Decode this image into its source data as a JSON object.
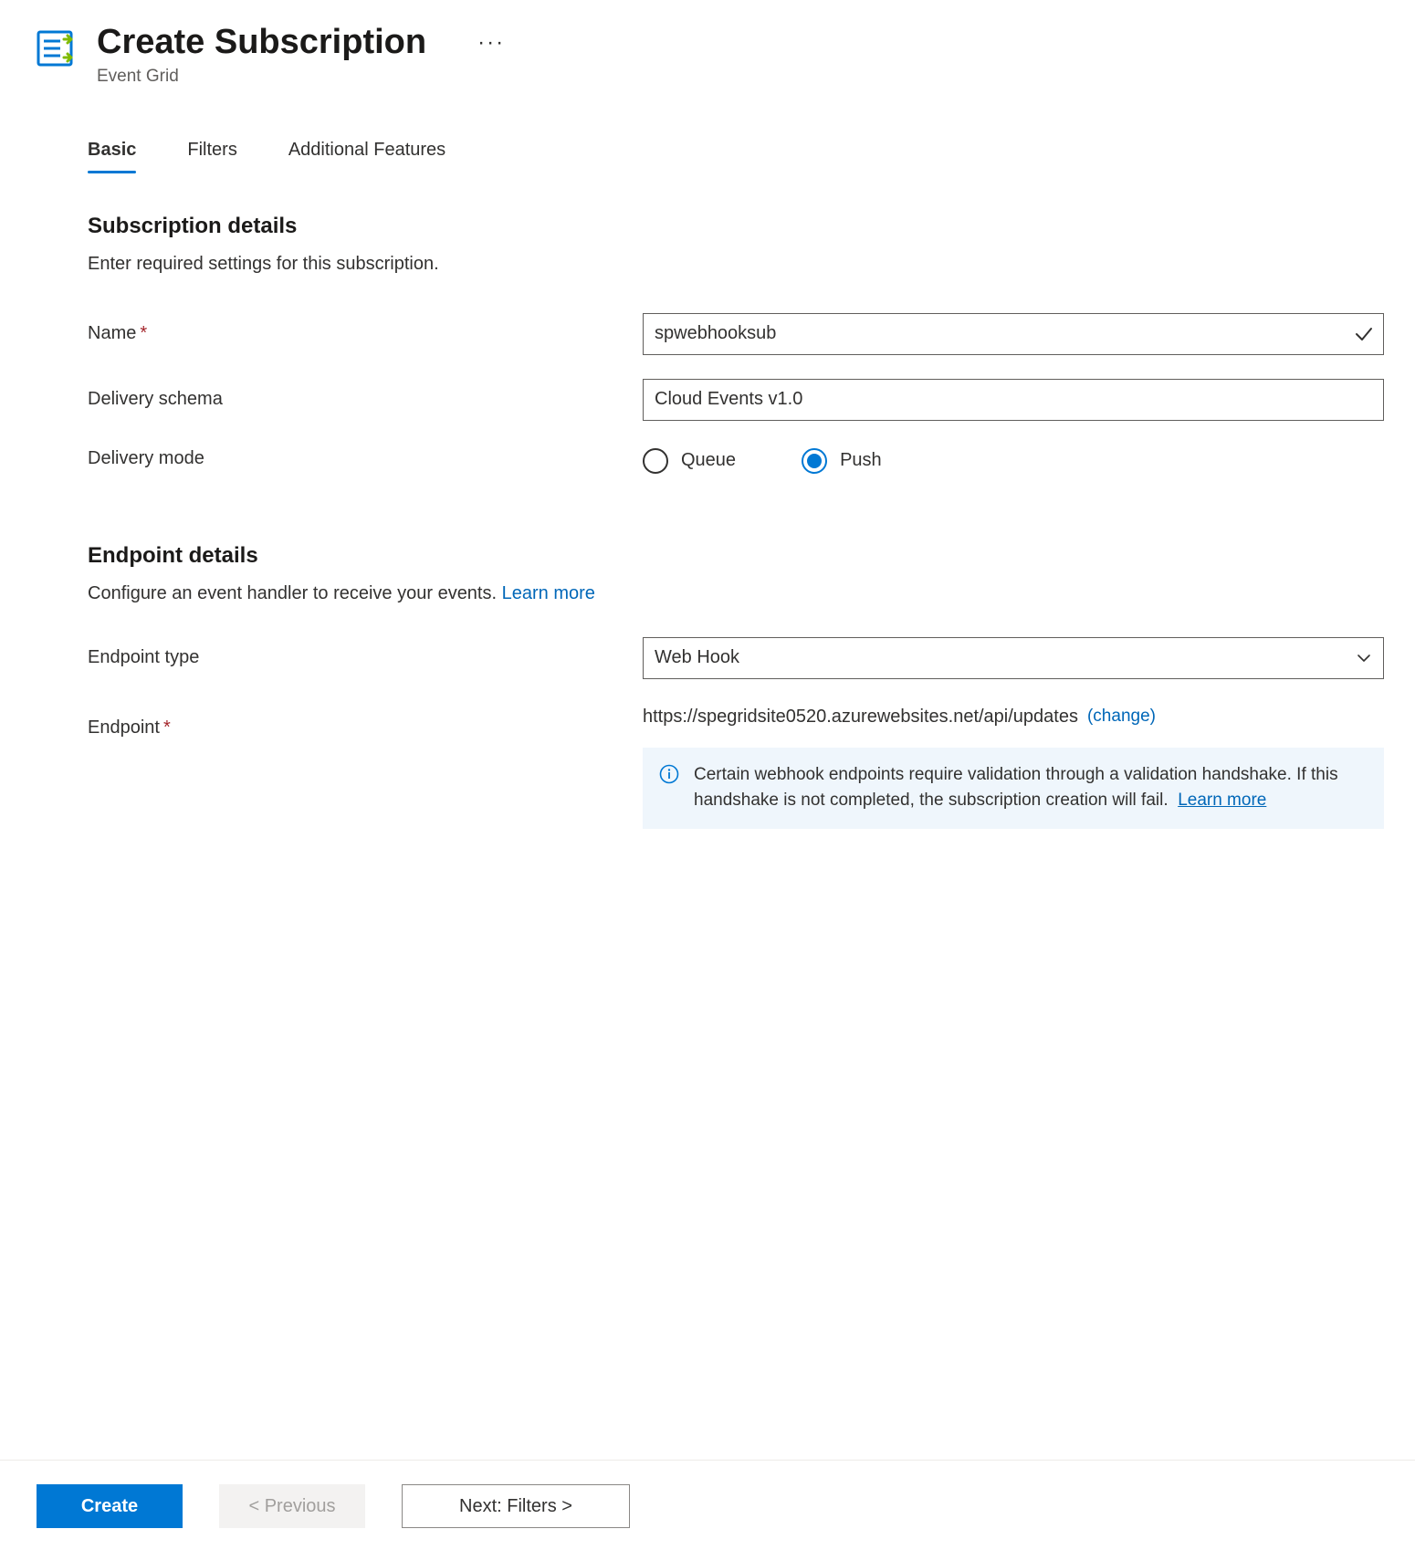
{
  "header": {
    "title": "Create Subscription",
    "subtitle": "Event Grid"
  },
  "tabs": [
    {
      "label": "Basic",
      "active": true
    },
    {
      "label": "Filters",
      "active": false
    },
    {
      "label": "Additional Features",
      "active": false
    }
  ],
  "subscription_details": {
    "heading": "Subscription details",
    "description": "Enter required settings for this subscription.",
    "rows": {
      "name": {
        "label": "Name",
        "required": true,
        "value": "spwebhooksub"
      },
      "delivery_schema": {
        "label": "Delivery schema",
        "value": "Cloud Events v1.0"
      },
      "delivery_mode": {
        "label": "Delivery mode",
        "options": [
          {
            "label": "Queue",
            "selected": false
          },
          {
            "label": "Push",
            "selected": true
          }
        ]
      }
    }
  },
  "endpoint_details": {
    "heading": "Endpoint details",
    "description": "Configure an event handler to receive your events.",
    "learn_more": "Learn more",
    "rows": {
      "endpoint_type": {
        "label": "Endpoint type",
        "value": "Web Hook"
      },
      "endpoint": {
        "label": "Endpoint",
        "required": true,
        "url": "https://spegridsite0520.azurewebsites.net/api/updates",
        "change_label": "(change)"
      }
    },
    "info_box": {
      "text": "Certain webhook endpoints require validation through a validation handshake. If this handshake is not completed, the subscription creation will fail.",
      "learn_more": "Learn more"
    }
  },
  "footer": {
    "create": "Create",
    "previous": "< Previous",
    "next": "Next: Filters >"
  }
}
